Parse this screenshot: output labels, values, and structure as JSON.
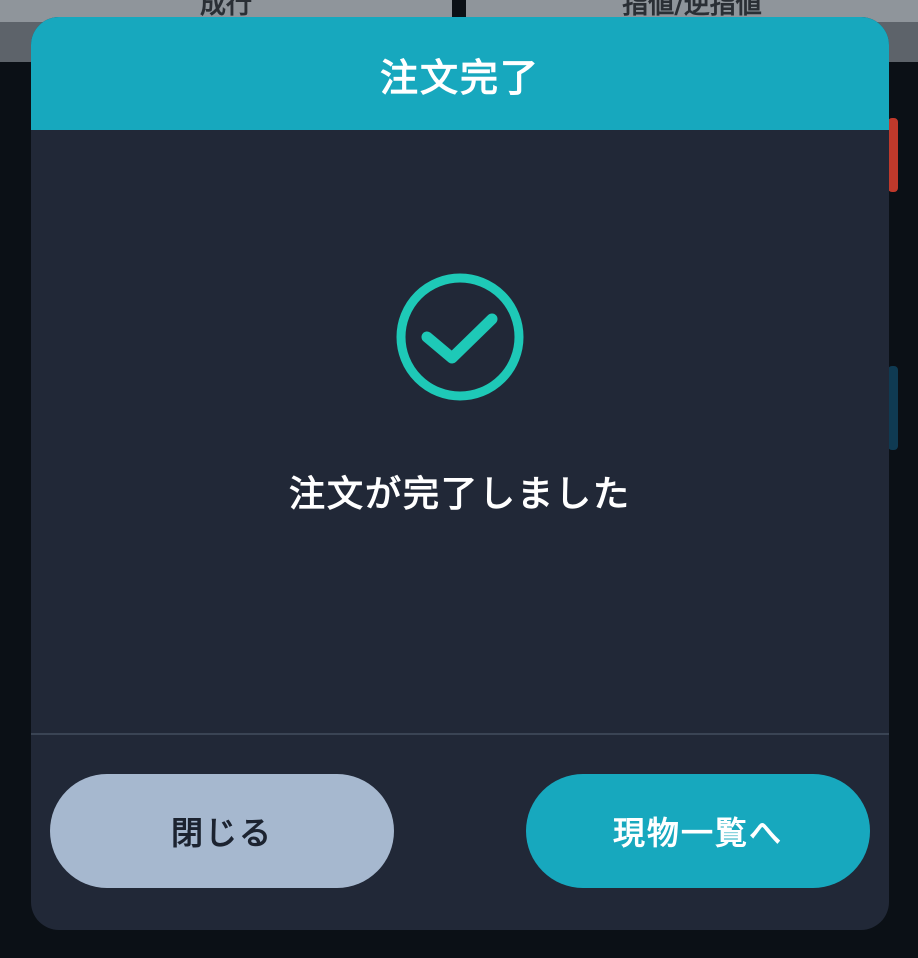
{
  "background": {
    "tab_left": "成行",
    "tab_right": "指値/逆指値"
  },
  "dialog": {
    "title": "注文完了",
    "message": "注文が完了しました",
    "status_icon": "check-circle-icon"
  },
  "buttons": {
    "close_label": "閉じる",
    "primary_label": "現物一覧へ"
  },
  "colors": {
    "accent": "#17a8be",
    "dialog_bg": "#212837",
    "check": "#1ec9b7",
    "close_button_bg": "#a6b8cf"
  }
}
